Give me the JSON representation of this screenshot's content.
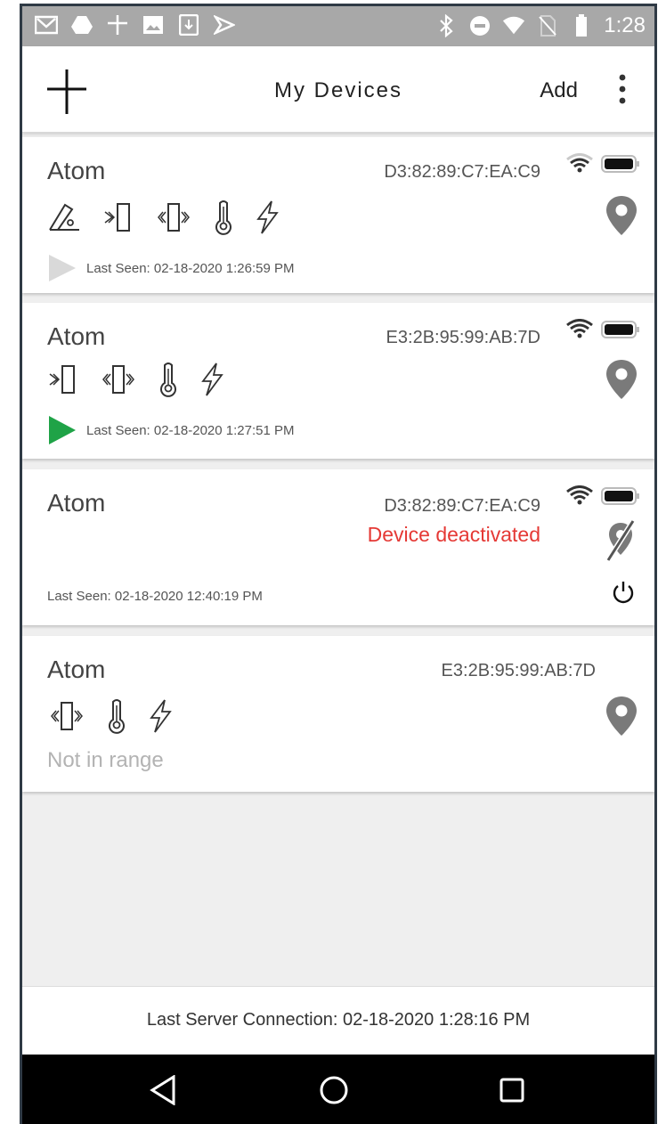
{
  "statusbar": {
    "time": "1:28",
    "icons": [
      "gmail-icon",
      "drive-icon",
      "app-logo-icon",
      "image-icon",
      "download-icon",
      "play-icon",
      "bluetooth-icon",
      "dnd-icon",
      "wifi-icon",
      "no-sim-icon",
      "battery-icon"
    ]
  },
  "appbar": {
    "title": "My Devices",
    "add_label": "Add",
    "menu_icon": "more-vert-icon"
  },
  "devices": [
    {
      "name": "Atom",
      "mac": "D3:82:89:C7:EA:C9",
      "sensors": [
        "tilt-sensor-icon",
        "door-sensor-icon",
        "vibration-sensor-icon",
        "thermometer-icon",
        "power-icon"
      ],
      "last_seen": "Last Seen: 02-18-2020 1:26:59 PM",
      "play_color": "#d9d9d9",
      "status": "",
      "location": "pin"
    },
    {
      "name": "Atom",
      "mac": "E3:2B:95:99:AB:7D",
      "sensors": [
        "door-sensor-icon",
        "vibration-sensor-icon",
        "thermometer-icon",
        "power-icon"
      ],
      "last_seen": "Last Seen: 02-18-2020 1:27:51 PM",
      "play_color": "#1fa347",
      "status": "",
      "location": "pin"
    },
    {
      "name": "Atom",
      "mac": "D3:82:89:C7:EA:C9",
      "sensors": [],
      "last_seen": "Last Seen: 02-18-2020 12:40:19 PM",
      "status": "Device deactivated",
      "location": "pin-off"
    },
    {
      "name": "Atom",
      "mac": "E3:2B:95:99:AB:7D",
      "sensors": [
        "vibration-sensor-icon",
        "thermometer-icon",
        "power-icon"
      ],
      "last_seen": "",
      "status": "Not in range",
      "location": "pin"
    }
  ],
  "footer": {
    "last_server_connection": "Last Server Connection: 02-18-2020 1:28:16 PM"
  },
  "colors": {
    "accent_green": "#1fa347",
    "deactivated_red": "#e53935",
    "icon_gray": "#7a7a7a",
    "statusbar": "#a8a8a8"
  }
}
